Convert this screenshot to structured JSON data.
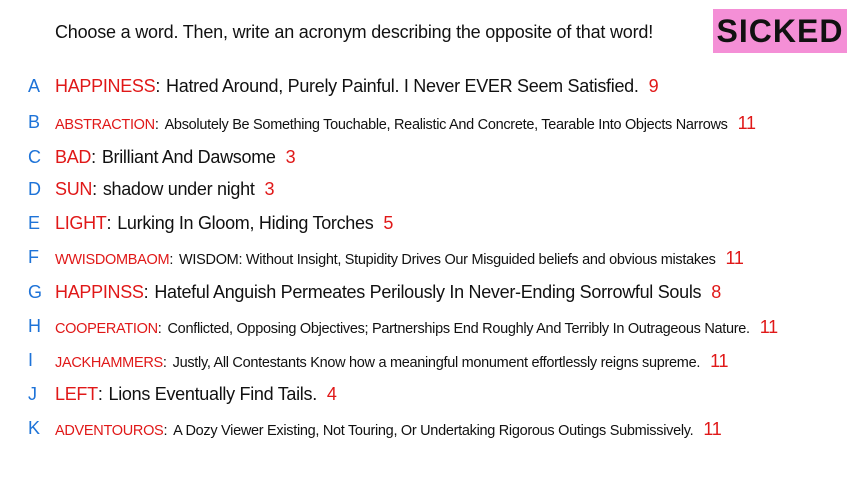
{
  "prompt": "Choose a word. Then, write an acronym describing the opposite of that word!",
  "badge": "SICKED",
  "colors": {
    "letter": "#1e73d8",
    "word": "#e01818",
    "badge_bg": "#f48fd6"
  },
  "entries": [
    {
      "letter": "A",
      "word": "HAPPINESS",
      "acronym": "Hatred Around, Purely Painful. I Never EVER Seem Satisfied.",
      "count": "9"
    },
    {
      "letter": "B",
      "word": "ABSTRACTION",
      "acronym": "Absolutely Be Something Touchable, Realistic And Concrete, Tearable Into Objects Narrows",
      "count": "11"
    },
    {
      "letter": "C",
      "word": "BAD",
      "acronym": "Brilliant And Dawsome",
      "count": "3"
    },
    {
      "letter": "D",
      "word": "SUN",
      "acronym": "shadow under night",
      "count": "3"
    },
    {
      "letter": "E",
      "word": "LIGHT",
      "acronym": "Lurking In Gloom, Hiding Torches",
      "count": "5"
    },
    {
      "letter": "F",
      "word": "WWISDOMBAOM",
      "acronym": "WISDOM: Without Insight, Stupidity Drives Our Misguided beliefs and obvious mistakes",
      "count": "11"
    },
    {
      "letter": "G",
      "word": "HAPPINSS",
      "acronym": "Hateful Anguish Permeates Perilously In Never-Ending Sorrowful Souls",
      "count": "8"
    },
    {
      "letter": "H",
      "word": "COOPERATION",
      "acronym": "Conflicted, Opposing Objectives; Partnerships End Roughly And Terribly In Outrageous Nature.",
      "count": "11"
    },
    {
      "letter": "I",
      "word": "JACKHAMMERS",
      "acronym": "Justly, All Contestants Know how a meaningful monument effortlessly reigns supreme.",
      "count": "11"
    },
    {
      "letter": "J",
      "word": "LEFT",
      "acronym": "Lions Eventually Find Tails.",
      "count": "4"
    },
    {
      "letter": "K",
      "word": "ADVENTOUROS",
      "acronym": "A Dozy Viewer Existing, Not Touring, Or Undertaking Rigorous Outings Submissively.",
      "count": "11"
    }
  ]
}
